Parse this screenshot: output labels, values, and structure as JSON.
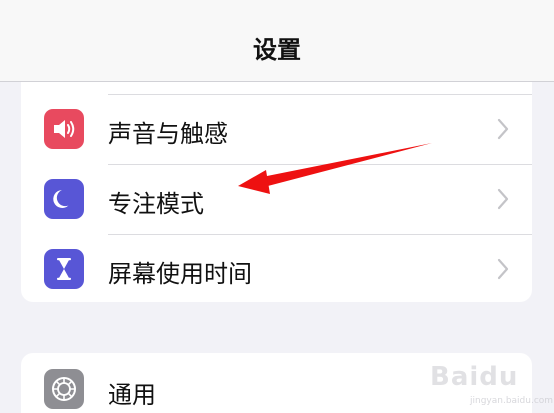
{
  "header": {
    "title": "设置"
  },
  "settings_group_1": [
    {
      "label": "声音与触感",
      "icon": "speaker-icon",
      "icon_color": "#e84a5f"
    },
    {
      "label": "专注模式",
      "icon": "moon-icon",
      "icon_color": "#5856d6"
    },
    {
      "label": "屏幕使用时间",
      "icon": "hourglass-icon",
      "icon_color": "#5856d6"
    }
  ],
  "settings_group_2": [
    {
      "label": "通用",
      "icon": "gear-icon",
      "icon_color": "#8e8e93"
    }
  ],
  "annotation": {
    "arrow_color": "#ee1111"
  },
  "watermark": {
    "text": "Baidu",
    "sub_text": "jingyan.baidu.com"
  }
}
